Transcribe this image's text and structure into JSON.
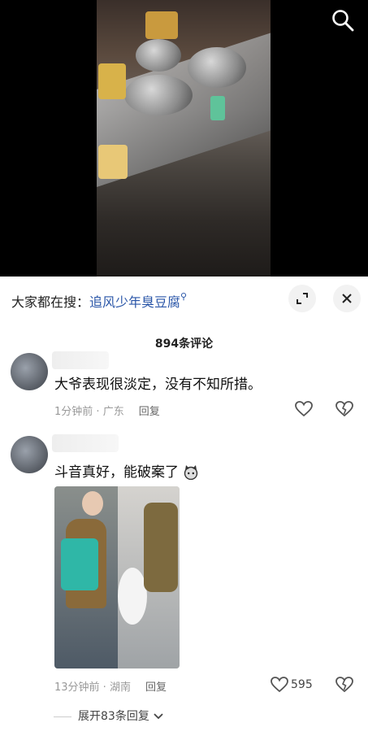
{
  "search_bar": {
    "prefix": "大家都在搜：",
    "query": "追风少年臭豆腐"
  },
  "comments_title": "894条评论",
  "comments": [
    {
      "text": "大爷表现很淡定，没有不知所措。",
      "time": "1分钟前",
      "location": "广东",
      "reply": "回复",
      "likes": ""
    },
    {
      "text": "斗音真好，能破案了",
      "time": "13分钟前",
      "location": "湖南",
      "reply": "回复",
      "likes": "595"
    }
  ],
  "expand_label": "展开83条回复",
  "icons": [
    "search-icon",
    "expand-icon",
    "close-icon",
    "heart-icon",
    "broken-heart-icon",
    "chevron-down-icon",
    "cat-emoji-icon"
  ],
  "colors": {
    "accent": "#2a56a8",
    "meta": "#999999",
    "sheet_bg": "#ffffff",
    "video_bg": "#000000"
  }
}
